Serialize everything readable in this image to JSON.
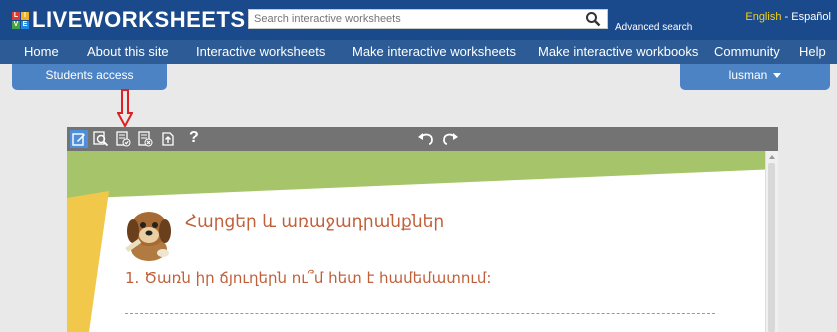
{
  "header": {
    "logo_text": "LIVEWORKSHEETS",
    "logo_letters": [
      "L",
      "I",
      "V",
      "E"
    ],
    "search_placeholder": "Search interactive worksheets",
    "advanced_search": "Advanced search",
    "lang_english": "English",
    "lang_sep": "-",
    "lang_spanish": "Español"
  },
  "nav": {
    "home": "Home",
    "about": "About this site",
    "interactive": "Interactive worksheets",
    "make_ws": "Make interactive worksheets",
    "make_wb": "Make interactive workbooks",
    "community": "Community",
    "help": "Help"
  },
  "tabs": {
    "students": "Students access",
    "user": "lusman"
  },
  "toolbar": {
    "help_label": "?"
  },
  "worksheet": {
    "title": "Հարցեր և առաջադրանքներ",
    "question1": "1. Ծառն իր ճյուղերն ու՞մ հետ է համեմատում:"
  },
  "colors": {
    "topbar": "#1a4a8c",
    "nav": "#2c5b96",
    "tab": "#4b83c5",
    "toolbar": "#737373",
    "accent_red": "#e02020",
    "worksheet_green": "#a6c46a",
    "worksheet_yellow": "#f2c84a",
    "text_orange": "#c0603a"
  },
  "icons": {
    "toolbar": [
      "edit-icon",
      "preview-icon",
      "check-answers-icon",
      "clear-icon",
      "export-icon",
      "help-icon",
      "undo-icon",
      "redo-icon"
    ],
    "search": "search-icon"
  }
}
